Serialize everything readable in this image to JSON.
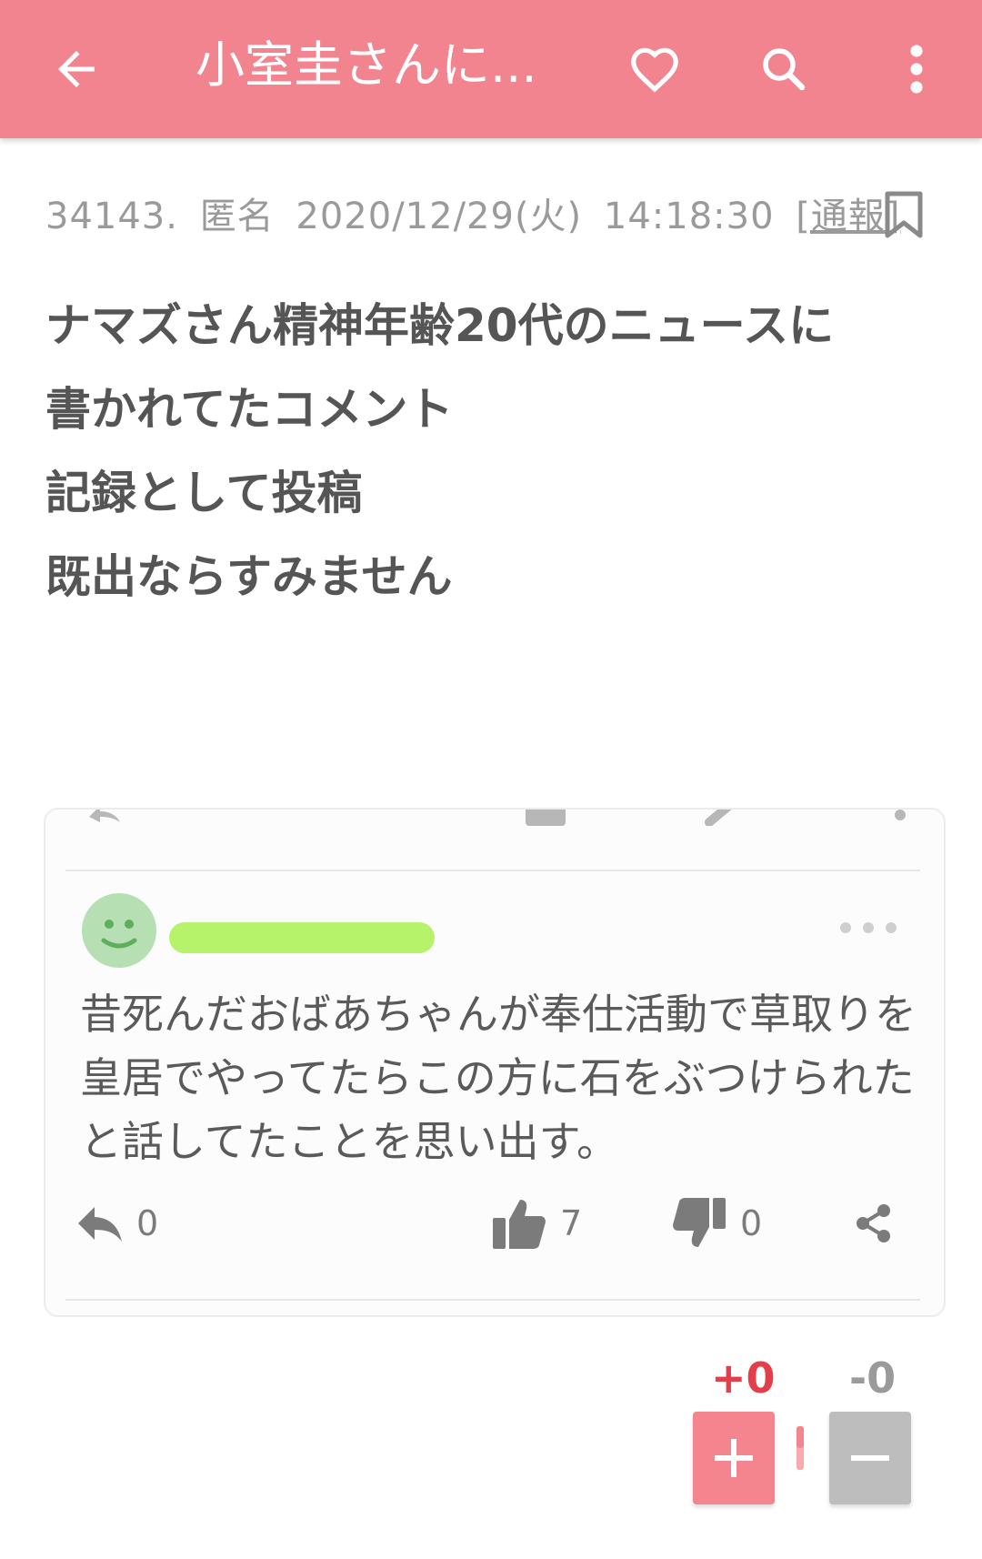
{
  "colors": {
    "accent": "#f2848f",
    "plus": "#e43e4b",
    "name_highlight": "#b7f26b"
  },
  "appbar": {
    "title": "小室圭さんに...",
    "back_icon": "arrow-left",
    "favorite_icon": "heart-outline",
    "search_icon": "magnifier",
    "menu_icon": "vertical-dots"
  },
  "post": {
    "number": "34143.",
    "author": "匿名",
    "date": "2020/12/29(火)",
    "time": "14:18:30",
    "report_label": "[通報]",
    "body_lines": [
      "ナマズさん精神年齢20代のニュースに",
      "書かれてたコメント",
      "記録として投稿",
      "既出ならすみません"
    ]
  },
  "embedded_comment": {
    "text": "昔死んだおばあちゃんが奉仕活動で草取りを皇居でやってたらこの方に石をぶつけられたと話してたことを思い出す。",
    "replies": "0",
    "likes": "7",
    "dislikes": "0"
  },
  "vote": {
    "plus_score": "+0",
    "minus_score": "-0",
    "plus_ratio": 0.5
  }
}
